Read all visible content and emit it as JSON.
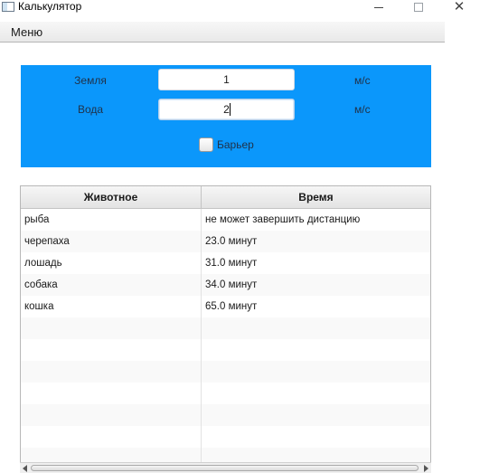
{
  "window": {
    "title": "Калькулятор",
    "icon": "app-window-icon",
    "controls": {
      "minimize_icon": "minimize-icon",
      "maximize_icon": "maximize-icon",
      "close_glyph": "✕"
    }
  },
  "menubar": {
    "menu_label": "Меню"
  },
  "input_panel": {
    "accent_color": "#0b97fb",
    "earth_label": "Земля",
    "earth_value": "1",
    "earth_unit": "м/с",
    "water_label": "Вода",
    "water_value": "2",
    "water_unit": "м/с",
    "barrier_label": "Барьер",
    "barrier_checked": false
  },
  "table": {
    "headers": {
      "animal": "Животное",
      "time": "Время"
    },
    "rows": [
      {
        "animal": "рыба",
        "time": "не может завершить дистанцию"
      },
      {
        "animal": "черепаха",
        "time": "23.0 минут"
      },
      {
        "animal": "лошадь",
        "time": "31.0 минут"
      },
      {
        "animal": "собака",
        "time": "34.0 минут"
      },
      {
        "animal": "кошка",
        "time": "65.0 минут"
      }
    ]
  }
}
